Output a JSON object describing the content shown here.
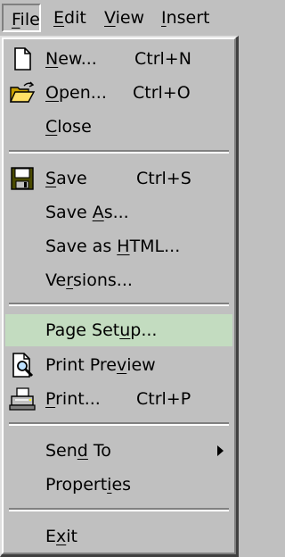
{
  "menubar": [
    {
      "pre": "",
      "key": "F",
      "post": "ile"
    },
    {
      "pre": "",
      "key": "E",
      "post": "dit"
    },
    {
      "pre": "",
      "key": "V",
      "post": "iew"
    },
    {
      "pre": "",
      "key": "I",
      "post": "nsert"
    }
  ],
  "file_menu": {
    "new": {
      "pre": "",
      "key": "N",
      "post": "ew...",
      "shortcut": "Ctrl+N",
      "icon": "new-document-icon"
    },
    "open": {
      "pre": "",
      "key": "O",
      "post": "pen...",
      "shortcut": "Ctrl+O",
      "icon": "open-folder-icon"
    },
    "close": {
      "pre": "",
      "key": "C",
      "post": "lose"
    },
    "save": {
      "pre": "",
      "key": "S",
      "post": "ave",
      "shortcut": "Ctrl+S",
      "icon": "save-disk-icon"
    },
    "save_as": {
      "pre": "Save ",
      "key": "A",
      "post": "s..."
    },
    "save_as_html": {
      "pre": "Save as ",
      "key": "H",
      "post": "TML..."
    },
    "versions": {
      "pre": "Ve",
      "key": "r",
      "post": "sions..."
    },
    "page_setup": {
      "pre": "Page Set",
      "key": "u",
      "post": "p...",
      "highlighted": true,
      "highlight_color": "#c3dcc0"
    },
    "print_preview": {
      "pre": "Print Pre",
      "key": "v",
      "post": "iew",
      "icon": "print-preview-icon"
    },
    "print": {
      "pre": "",
      "key": "P",
      "post": "rint...",
      "shortcut": "Ctrl+P",
      "icon": "printer-icon"
    },
    "send_to": {
      "pre": "Sen",
      "key": "d",
      "post": " To",
      "submenu": true
    },
    "properties": {
      "pre": "Propert",
      "key": "i",
      "post": "es"
    },
    "exit": {
      "pre": "E",
      "key": "x",
      "post": "it"
    }
  }
}
